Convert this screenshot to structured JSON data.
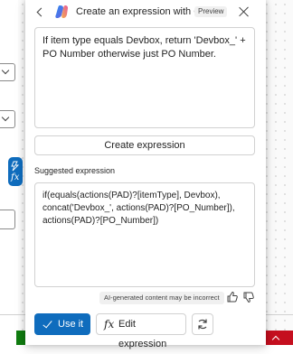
{
  "background": {
    "fx_badge_icon": "fx-formula-icon"
  },
  "panel": {
    "title": "Create an expression with Copilot",
    "preview_badge": "Preview",
    "prompt_text": "If item type equals Devbox, return 'Devbox_' + PO Number otherwise just PO Number.",
    "create_button_label": "Create expression",
    "suggested_label": "Suggested expression",
    "suggested_expression": "if(equals(actions(PAD)?[itemType], Devbox), concat('Devbox_', actions(PAD)?[PO_Number]), actions(PAD)?[PO_Number])",
    "ai_disclaimer": "AI-generated content may be incorrect",
    "use_button_label": "Use it",
    "edit_button_label": "Edit expression",
    "fx_symbol": "fx"
  },
  "colors": {
    "accent": "#0f6cbd",
    "border": "#d1d1d1",
    "badge_bg": "#f0f0f0"
  }
}
